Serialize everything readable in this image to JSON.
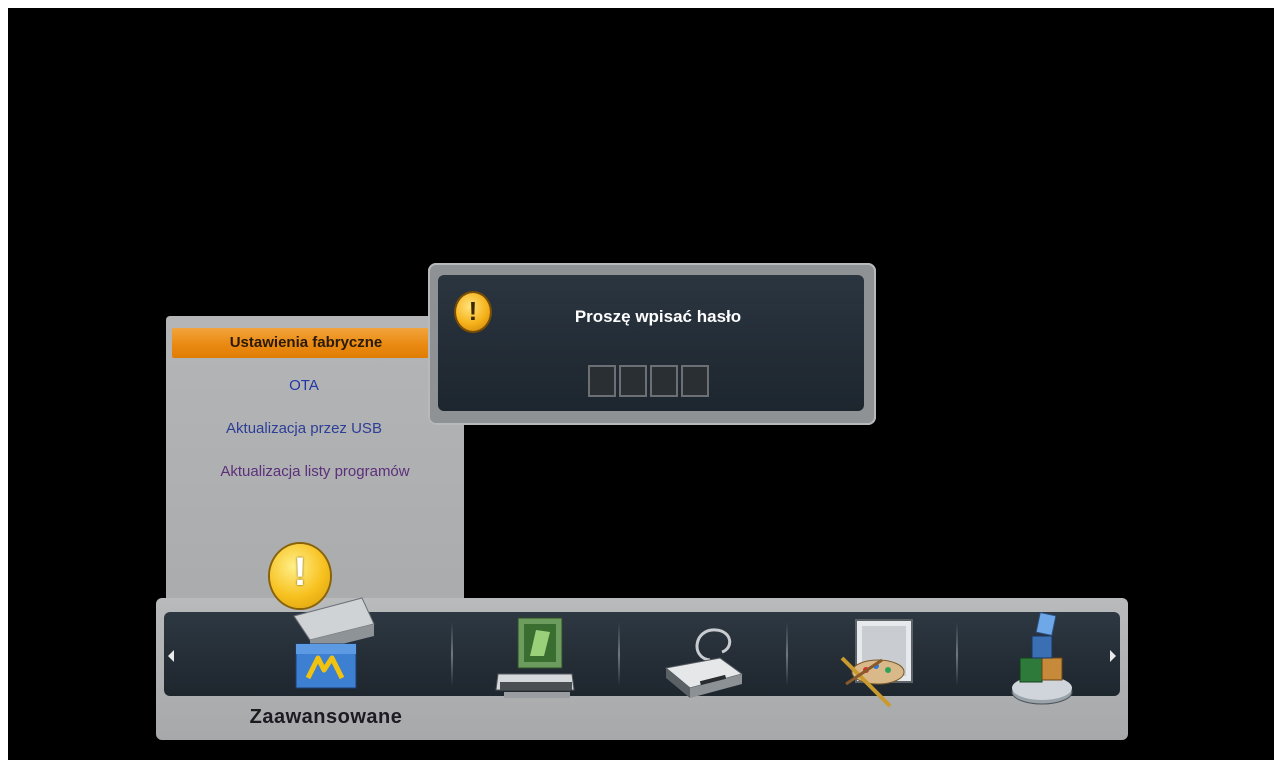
{
  "submenu": {
    "items": [
      {
        "label": "Ustawienia fabryczne",
        "selected": true
      },
      {
        "label": "OTA"
      },
      {
        "label": "Aktualizacja przez USB"
      },
      {
        "label": "Aktualizacja listy programów"
      }
    ]
  },
  "dialog": {
    "title": "Proszę wpisać hasło",
    "pin_length": 4
  },
  "menubar": {
    "selected_label": "Zaawansowane",
    "icons": [
      "advanced-settings-icon",
      "channel-search-icon",
      "connection-icon",
      "display-settings-icon",
      "apps-icon"
    ]
  },
  "colors": {
    "highlight": "#ea8a12",
    "warning": "#f6b21a"
  }
}
